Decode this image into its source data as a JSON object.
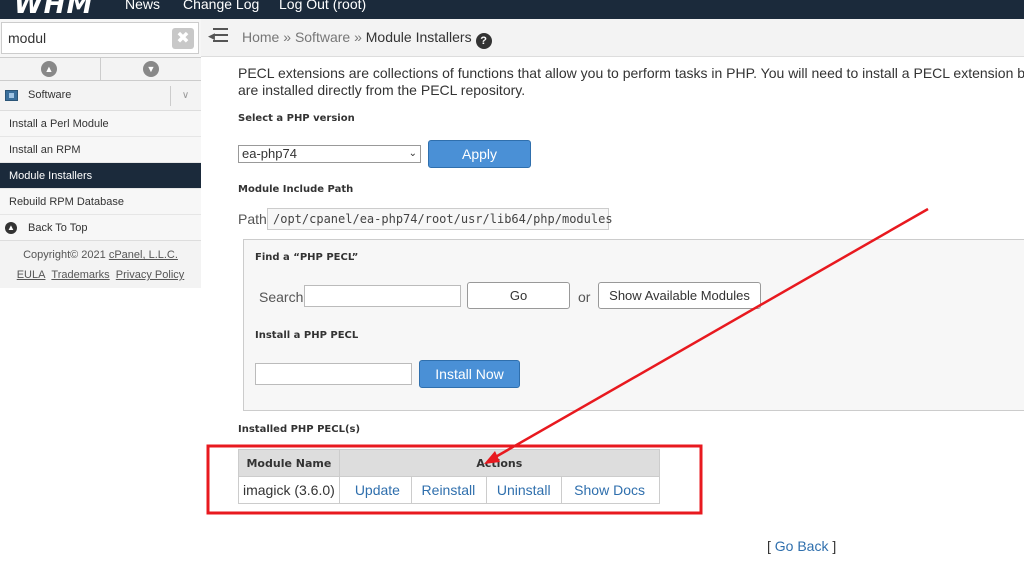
{
  "header": {
    "logo_text": "WHM",
    "nav": [
      "News",
      "Change Log",
      "Log Out (root)"
    ]
  },
  "sidebar": {
    "search_value": "modul",
    "clear_label": "✖",
    "category": "Software",
    "items": [
      {
        "label": "Install a Perl Module",
        "active": false
      },
      {
        "label": "Install an RPM",
        "active": false
      },
      {
        "label": "Module Installers",
        "active": true
      },
      {
        "label": "Rebuild RPM Database",
        "active": false
      }
    ],
    "back_to_top": "Back To Top",
    "footer": {
      "copyright_prefix": "Copyright© 2021 ",
      "copyright_link": "cPanel, L.L.C.",
      "links": [
        "EULA",
        "Trademarks",
        "Privacy Policy"
      ]
    }
  },
  "breadcrumb": {
    "home": "Home",
    "sep": " » ",
    "section": "Software",
    "current": "Module Installers",
    "help": "?"
  },
  "main": {
    "intro_line1": "PECL extensions are collections of functions that allow you to perform tasks in PHP. You will need to install a PECL extension before",
    "intro_line2": "are installed directly from the PECL repository.",
    "select_heading": "Select a PHP version",
    "php_version": "ea-php74",
    "apply_label": "Apply",
    "include_heading": "Module Include Path",
    "path_label": "Path",
    "path_value": "/opt/cpanel/ea-php74/root/usr/lib64/php/modules",
    "find_heading": "Find a “PHP PECL”",
    "search_label": "Search",
    "go_label": "Go",
    "or_label": "or",
    "show_modules_label": "Show Available Modules",
    "install_heading": "Install a PHP PECL",
    "install_now_label": "Install Now",
    "installed_heading": "Installed PHP PECL(s)",
    "table": {
      "headers": [
        "Module Name",
        "Actions"
      ],
      "rows": [
        {
          "name": "imagick (3.6.0)",
          "actions": [
            "Update",
            "Reinstall",
            "Uninstall",
            "Show Docs"
          ]
        }
      ]
    },
    "go_back_open": "[ ",
    "go_back_label": "Go Back",
    "go_back_close": " ]"
  },
  "annotation": {
    "color": "#e8191f"
  }
}
